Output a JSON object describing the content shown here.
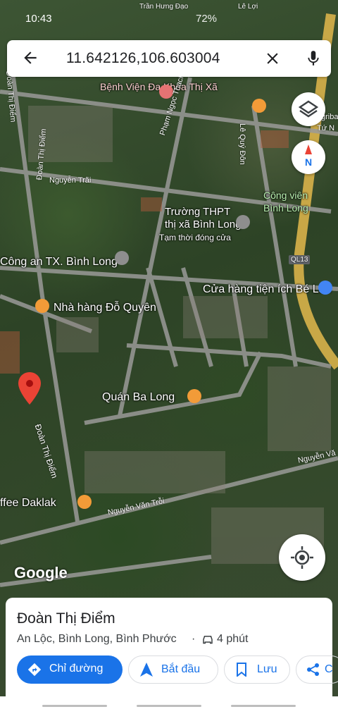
{
  "status_bar": {
    "time": "10:43",
    "battery": "72%"
  },
  "search": {
    "query": "11.642126,106.603004"
  },
  "map": {
    "places": [
      {
        "name": "Bệnh Viện Đa Khoa Thị Xã"
      },
      {
        "name": "Công viên Bình Long"
      },
      {
        "name": "Trường THPT thị xã Bình Long",
        "note": "Tạm thời đóng cửa"
      },
      {
        "name": "Công an TX. Bình Long"
      },
      {
        "name": "Cửa hàng tiện ích Bé Lan"
      },
      {
        "name": "Nhà hàng Đỗ Quyên"
      },
      {
        "name": "Quán Ba Long"
      },
      {
        "name": "ffee Daklak"
      }
    ],
    "roads": [
      "Đoàn Thị Điểm",
      "Nguyễn Trãi",
      "Phạm Ngọc Thạch",
      "Lê Quý Đôn",
      "QL13",
      "Nguyễn Văn Trỗi",
      "Trần Hưng Đạo",
      "Lê Lợi",
      "Đoàn Thị Điểm",
      "Đoàn Thị Điểm",
      "Nguyễn Vă"
    ],
    "partial_labels": [
      "gribank",
      "Tứ N"
    ],
    "attribution": "Google"
  },
  "place_card": {
    "title": "Đoàn Thị Điểm",
    "address": "An Lộc, Bình Long, Bình Phước",
    "separator": "·",
    "travel_time": "4 phút",
    "buttons": {
      "directions": "Chỉ đường",
      "start": "Bắt đầu",
      "save": "Lưu",
      "share": "C"
    }
  },
  "colors": {
    "accent": "#1a73e8",
    "pin": "#ea4335",
    "food": "#f29b38",
    "road_yellow": "#d9b24a"
  }
}
